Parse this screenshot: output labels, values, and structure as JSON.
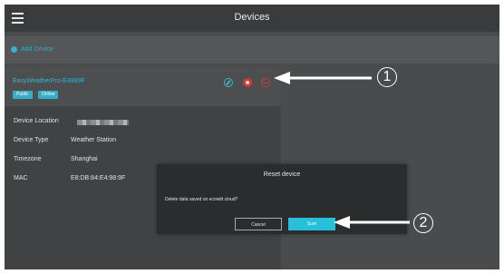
{
  "header": {
    "title": "Devices"
  },
  "toolbar": {
    "add_label": "Add Device"
  },
  "device": {
    "name": "EasyWeatherPro-E4989F",
    "badges": [
      "Public",
      "Online"
    ],
    "details": [
      {
        "label": "Device Location",
        "value": ""
      },
      {
        "label": "Device Type",
        "value": "Weather Station"
      },
      {
        "label": "Timezone",
        "value": "Shanghai"
      },
      {
        "label": "MAC",
        "value": "E8:DB:84:E4:98:9F"
      }
    ]
  },
  "dialog": {
    "title": "Reset device",
    "message": "Delete data saved on ecowitt cloud?",
    "cancel_label": "Cancel",
    "confirm_label": "Sure"
  },
  "callouts": [
    "1",
    "2"
  ],
  "icons": {
    "menu": "hamburger-icon",
    "add": "plus-circle-icon",
    "edit": "pencil-icon",
    "delete": "delete-icon",
    "reset": "reset-icon"
  },
  "colors": {
    "accent": "#3ab2cc",
    "danger": "#cf3b3b",
    "confirm": "#28c0d8"
  }
}
